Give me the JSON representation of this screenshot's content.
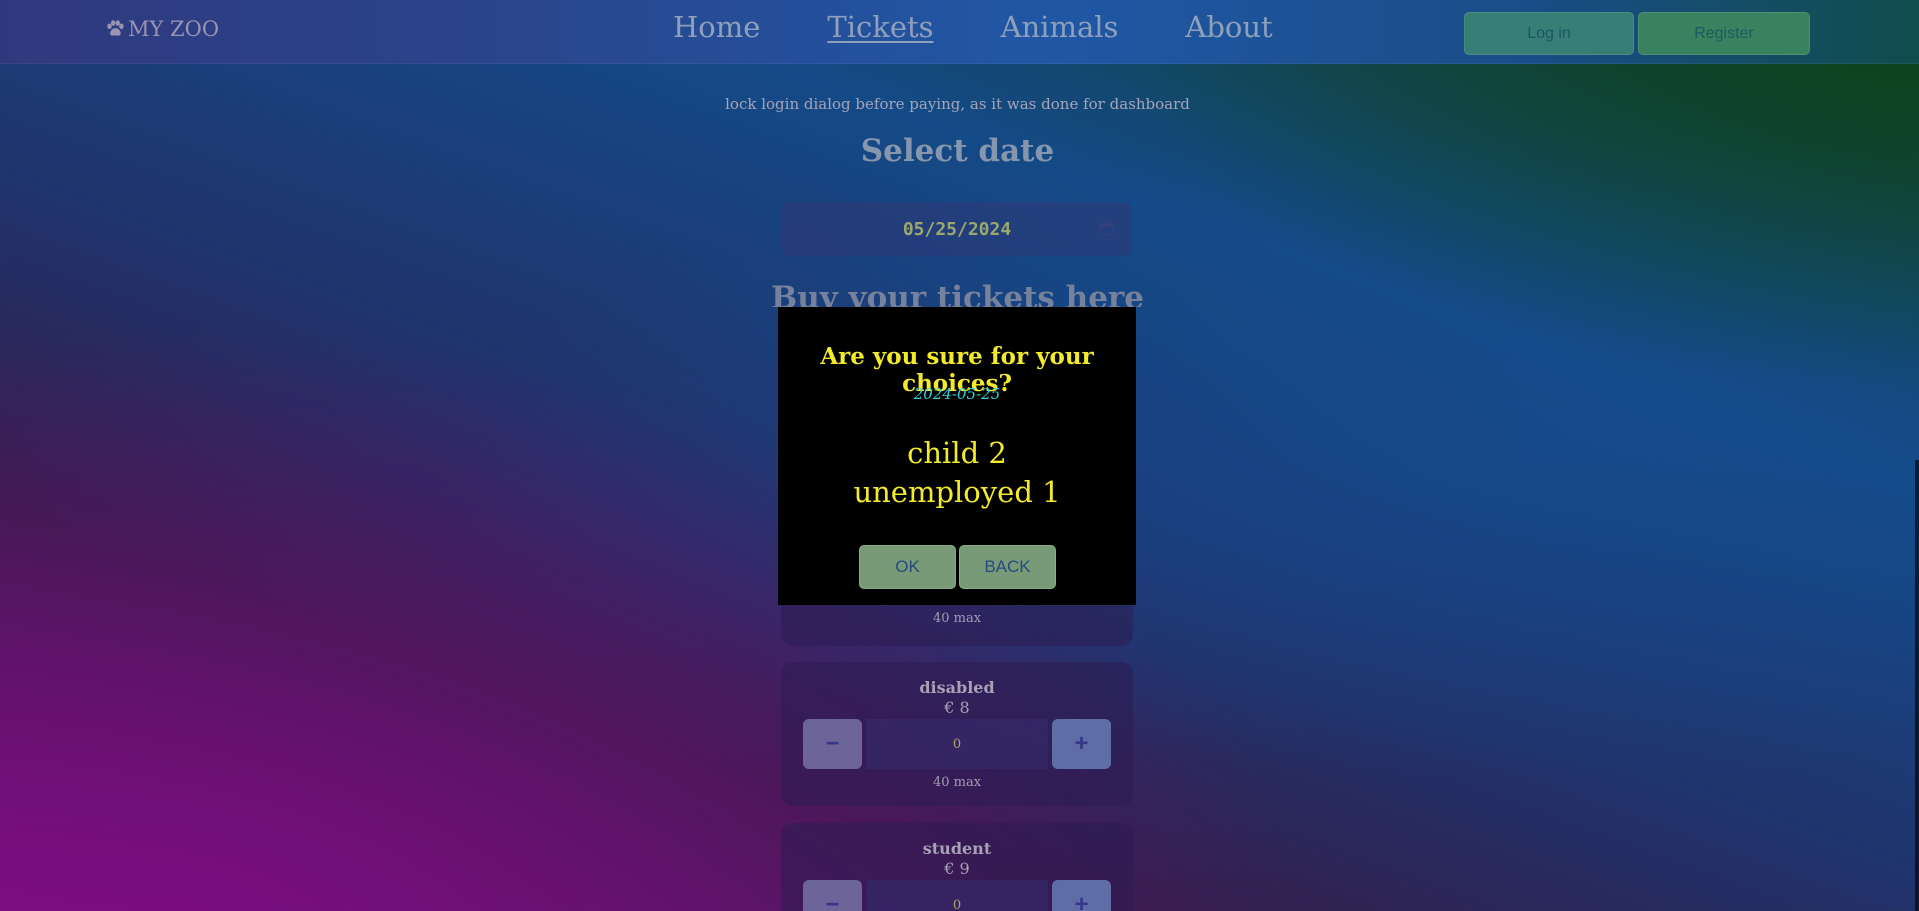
{
  "navbar": {
    "brand": "MY ZOO",
    "brand_icon": "paw-icon",
    "links": [
      {
        "label": "Home",
        "active": false
      },
      {
        "label": "Tickets",
        "active": true
      },
      {
        "label": "Animals",
        "active": false
      },
      {
        "label": "About",
        "active": false
      }
    ],
    "login_label": "Log in",
    "register_label": "Register"
  },
  "main": {
    "note": "lock login dialog before paying, as it was done for dashboard",
    "select_date_title": "Select date",
    "date_value": "05/25/2024",
    "date_icon": "calendar-icon",
    "buy_title": "Buy your tickets here",
    "tickets": [
      {
        "name": "",
        "price": "",
        "quantity": "",
        "max": "40 max"
      },
      {
        "name": "disabled",
        "price": "€ 8",
        "quantity": "0",
        "max": "40 max",
        "minus": "−",
        "plus": "+"
      },
      {
        "name": "student",
        "price": "€ 9",
        "quantity": "0",
        "max": "",
        "minus": "−",
        "plus": "+"
      }
    ]
  },
  "modal": {
    "title": "Are you sure for your choices?",
    "date": "2024-05-25",
    "choices": [
      "child 2",
      "unemployed 1"
    ],
    "ok_label": "OK",
    "back_label": "BACK"
  },
  "colors": {
    "modal_title": "#f2ea2a",
    "modal_date": "#2fd3e0",
    "button_green": "#789a76",
    "nav_text": "#a9bfd9"
  }
}
